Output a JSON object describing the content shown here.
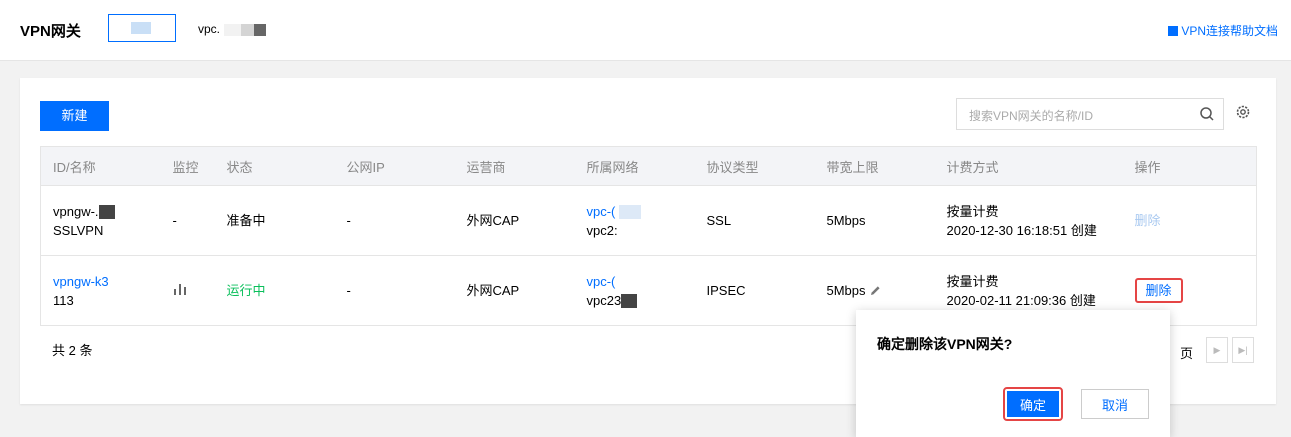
{
  "header": {
    "title": "VPN网关",
    "vpc_select_prefix": "vpc.",
    "help_link": "VPN连接帮助文档"
  },
  "toolbar": {
    "new_label": "新建",
    "search_placeholder": "搜索VPN网关的名称/ID"
  },
  "table": {
    "columns": [
      "ID/名称",
      "监控",
      "状态",
      "公网IP",
      "运营商",
      "所属网络",
      "协议类型",
      "带宽上限",
      "计费方式",
      "操作"
    ],
    "rows": [
      {
        "id": "vpngw-.",
        "name": "SSLVPN",
        "monitor": "-",
        "status": "准备中",
        "public_ip": "-",
        "isp": "外网CAP",
        "network_id": "vpc-(",
        "network_name": "vpc2:",
        "protocol": "SSL",
        "bandwidth": "5Mbps",
        "billing": "按量计费",
        "created": "2020-12-30 16:18:51 创建",
        "action": "删除"
      },
      {
        "id": "vpngw-k3",
        "name": "113",
        "monitor_icon": "bar-chart-icon",
        "status": "运行中",
        "public_ip": "-",
        "isp": "外网CAP",
        "network_id": "vpc-(",
        "network_name": "vpc23",
        "protocol": "IPSEC",
        "bandwidth": "5Mbps",
        "billing": "按量计费",
        "created": "2020-02-11 21:09:36 创建",
        "action": "删除"
      }
    ]
  },
  "footer": {
    "total": "共 2 条",
    "page_suffix": "页"
  },
  "popover": {
    "message": "确定删除该VPN网关?",
    "confirm": "确定",
    "cancel": "取消"
  },
  "colors": {
    "accent": "#006eff",
    "running": "#0abf5b",
    "highlight": "#e54545"
  }
}
